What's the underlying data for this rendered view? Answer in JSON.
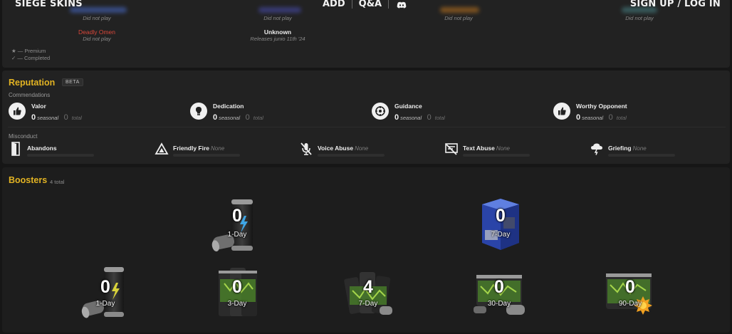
{
  "nav": {
    "brand": "SIEGE SKINS",
    "add": "ADD",
    "qa": "Q&A",
    "signup": "SIGN UP / LOG IN",
    "discord_icon": "discord-icon"
  },
  "season": {
    "entries": [
      {
        "status": "Did not play",
        "accent": "#4a6fd6"
      },
      {
        "status": "Did not play",
        "accent": "#4a4fb8"
      },
      {
        "status": "Did not play",
        "accent": "#c7791e"
      },
      {
        "status": "Did not play",
        "accent": "#4a8a8e"
      }
    ],
    "deadly_omen": {
      "name": "Deadly Omen",
      "status": "Did not play",
      "color": "#d9473a"
    },
    "unknown": {
      "name": "Unknown",
      "status": "Releases junio 11th '24"
    },
    "legend_premium": "★ — Premium",
    "legend_completed": "✓ — Completed"
  },
  "reputation": {
    "title": "Reputation",
    "badge": "BETA",
    "commendations_label": "Commendations",
    "commendations": [
      {
        "name": "Valor",
        "seasonal": "0",
        "seasonal_label": "seasonal",
        "total": "0",
        "total_label": "total",
        "icon": "thumbs-up-icon"
      },
      {
        "name": "Dedication",
        "seasonal": "0",
        "seasonal_label": "seasonal",
        "total": "0",
        "total_label": "total",
        "icon": "lightbulb-icon"
      },
      {
        "name": "Guidance",
        "seasonal": "0",
        "seasonal_label": "seasonal",
        "total": "0",
        "total_label": "total",
        "icon": "compass-icon"
      },
      {
        "name": "Worthy Opponent",
        "seasonal": "0",
        "seasonal_label": "seasonal",
        "total": "0",
        "total_label": "total",
        "icon": "thumbs-up-icon"
      }
    ],
    "misconduct_label": "Misconduct",
    "misconduct": [
      {
        "name": "Abandons",
        "value": "",
        "icon": "door-icon"
      },
      {
        "name": "Friendly Fire",
        "value": "None",
        "icon": "triangle-icon"
      },
      {
        "name": "Voice Abuse",
        "value": "None",
        "icon": "muted-mic-icon"
      },
      {
        "name": "Text Abuse",
        "value": "None",
        "icon": "text-abuse-icon"
      },
      {
        "name": "Griefing",
        "value": "None",
        "icon": "storm-cloud-icon"
      }
    ]
  },
  "boosters": {
    "title": "Boosters",
    "count": "4 total",
    "items": [
      {
        "count": "0",
        "label": "1-Day",
        "kind": "can-blue"
      },
      {
        "count": "0",
        "label": "7-Day",
        "kind": "box-blue"
      },
      {
        "count": "0",
        "label": "1-Day",
        "kind": "can-yellow"
      },
      {
        "count": "0",
        "label": "3-Day",
        "kind": "pack-green"
      },
      {
        "count": "4",
        "label": "7-Day",
        "kind": "pack-green"
      },
      {
        "count": "0",
        "label": "30-Day",
        "kind": "pack-green"
      },
      {
        "count": "0",
        "label": "90-Day",
        "kind": "pack-green-star"
      }
    ]
  }
}
